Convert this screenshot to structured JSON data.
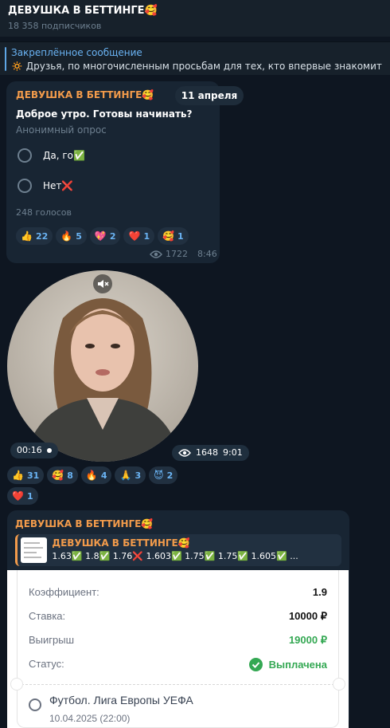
{
  "header": {
    "title": "ДЕВУШКА В БЕТТИНГЕ🥰",
    "subscribers": "18 358 подписчиков"
  },
  "pinned": {
    "label": "Закреплённое сообщение",
    "text": "🔅 Друзья, по многочисленным просьбам для тех, кто впервые знакомится"
  },
  "date_pill": "11 апреля",
  "poll": {
    "channel": "ДЕВУШКА В БЕТТИНГЕ🥰",
    "question": "Доброе утро. Готовы начинать?",
    "type": "Анонимный опрос",
    "options": [
      "Да, го✅",
      "Нет❌"
    ],
    "votes": "248 голосов",
    "reactions": [
      {
        "emoji": "👍",
        "count": "22"
      },
      {
        "emoji": "🔥",
        "count": "5"
      },
      {
        "emoji": "💖",
        "count": "2"
      },
      {
        "emoji": "❤️",
        "count": "1"
      },
      {
        "emoji": "🥰",
        "count": "1"
      }
    ],
    "views": "1722",
    "time": "8:46"
  },
  "video": {
    "duration": "00:16",
    "views": "1648",
    "time": "9:01",
    "mute_icon": "speaker-muted-icon",
    "reactions": [
      {
        "emoji": "👍",
        "count": "31"
      },
      {
        "emoji": "🥰",
        "count": "8"
      },
      {
        "emoji": "🔥",
        "count": "4"
      },
      {
        "emoji": "🙏",
        "count": "3"
      },
      {
        "emoji": "😈",
        "count": "2"
      },
      {
        "emoji": "❤️",
        "count": "1"
      }
    ]
  },
  "post": {
    "channel": "ДЕВУШКА В БЕТТИНГЕ🥰",
    "forward_name": "ДЕВУШКА В БЕТТИНГЕ🥰",
    "forward_text": "1.63✅ 1.8✅ 1.76❌ 1.603✅ 1.75✅ 1.75✅ 1.605✅ ..."
  },
  "slip": {
    "coef_label": "Коэффициент:",
    "coef_value": "1.9",
    "stake_label": "Ставка:",
    "stake_value": "10000 ₽",
    "win_label": "Выигрыш",
    "win_value": "19000 ₽",
    "status_label": "Статус:",
    "status_value": "Выплачена",
    "match": "Футбол. Лига Европы УЕФА",
    "match_date": "10.04.2025 (22:00)"
  },
  "colors": {
    "bg": "#0e1621",
    "bubble": "#182533",
    "accent": "#6ab3f3",
    "channel": "#f29b4b",
    "paid": "#34a853"
  }
}
